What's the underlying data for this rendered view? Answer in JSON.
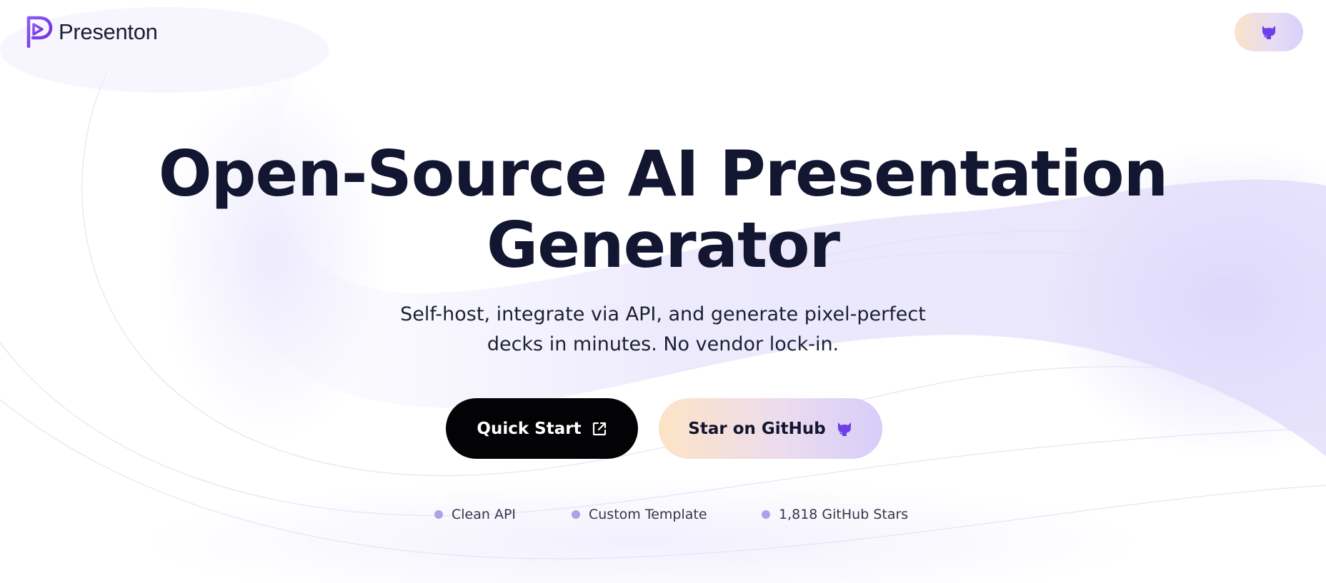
{
  "brand": {
    "name": "Presenton",
    "logo_icon": "presenton-play-logo-icon",
    "accent_color": "#7c3aed"
  },
  "header": {
    "github_icon": "github-icon"
  },
  "hero": {
    "title_line1": "Open-Source AI Presentation",
    "title_line2": "Generator",
    "subtitle_line1": "Self-host, integrate via API, and generate pixel-perfect",
    "subtitle_line2": "decks in minutes. No vendor lock-in."
  },
  "buttons": {
    "quick_start": {
      "label": "Quick Start",
      "icon": "external-link-icon"
    },
    "github": {
      "label": "Star on GitHub",
      "icon": "github-icon"
    }
  },
  "features": [
    {
      "label": "Clean API"
    },
    {
      "label": "Custom Template"
    },
    {
      "label": "1,818 GitHub Stars"
    }
  ],
  "colors": {
    "text_dark": "#121630",
    "button_dark": "#030305",
    "bullet": "#a9a4e6",
    "gradient_peach": "#fde3c5",
    "gradient_lavender": "#d7cdfa",
    "github_icon": "#6d3fe6"
  }
}
